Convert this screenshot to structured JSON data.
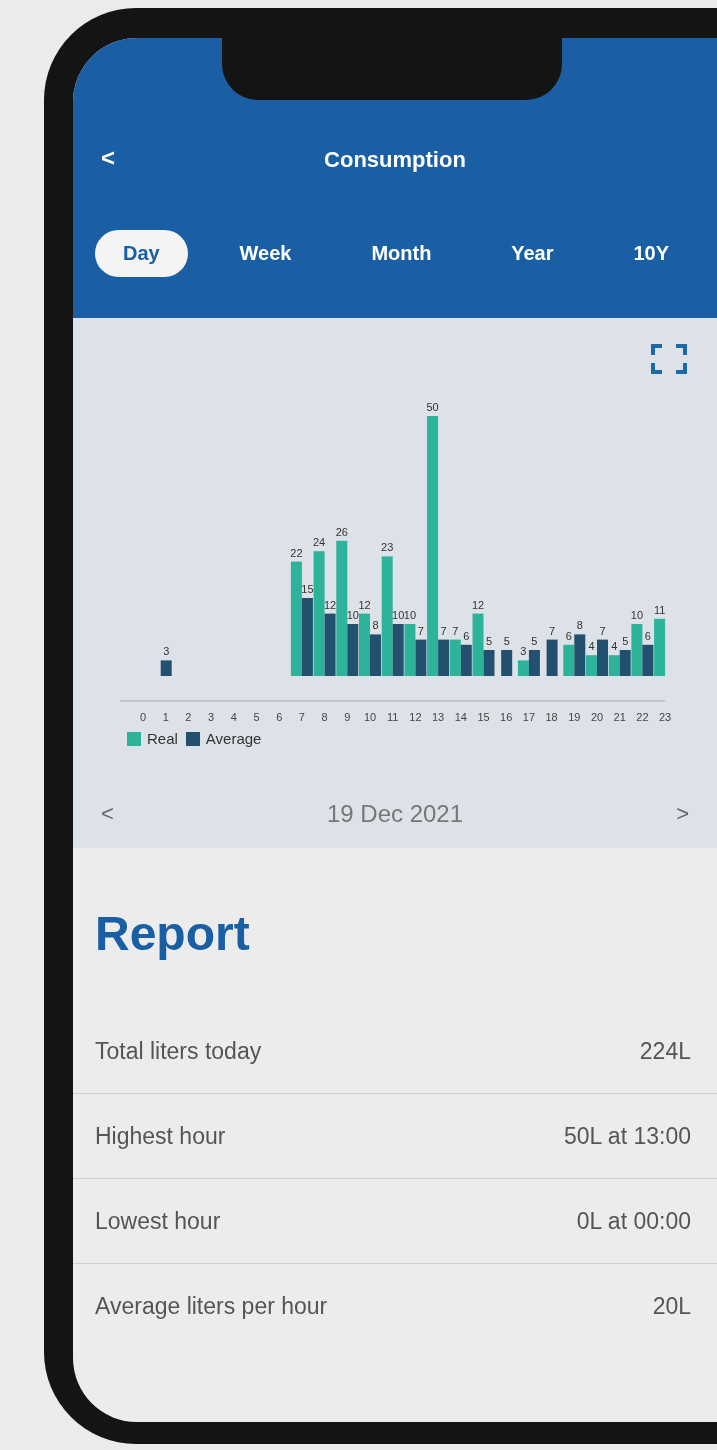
{
  "header": {
    "title": "Consumption",
    "back": "<"
  },
  "tabs": [
    {
      "label": "Day",
      "selected": true
    },
    {
      "label": "Week",
      "selected": false
    },
    {
      "label": "Month",
      "selected": false
    },
    {
      "label": "Year",
      "selected": false
    },
    {
      "label": "10Y",
      "selected": false
    }
  ],
  "chart": {
    "chart_data": {
      "type": "bar",
      "categories": [
        "0",
        "1",
        "2",
        "3",
        "4",
        "5",
        "6",
        "7",
        "8",
        "9",
        "10",
        "11",
        "12",
        "13",
        "14",
        "15",
        "16",
        "17",
        "18",
        "19",
        "20",
        "21",
        "22",
        "23"
      ],
      "data_labels": true,
      "series": [
        {
          "name": "Real",
          "color": "#2db39a",
          "values": [
            null,
            null,
            null,
            null,
            null,
            null,
            null,
            22,
            24,
            26,
            12,
            23,
            10,
            50,
            7,
            12,
            null,
            3,
            null,
            6,
            4,
            4,
            10,
            11
          ]
        },
        {
          "name": "Average",
          "color": "#24506f",
          "values": [
            null,
            3,
            null,
            null,
            null,
            null,
            null,
            15,
            12,
            10,
            8,
            10,
            7,
            7,
            6,
            5,
            5,
            5,
            7,
            8,
            7,
            5,
            6,
            null
          ]
        }
      ]
    }
  },
  "date_nav": {
    "prev": "<",
    "date": "19 Dec 2021",
    "next": ">"
  },
  "report": {
    "title": "Report",
    "rows": [
      {
        "label": "Total liters today",
        "value": "224L"
      },
      {
        "label": "Highest hour",
        "value": "50L at 13:00"
      },
      {
        "label": "Lowest hour",
        "value": "0L at 00:00"
      },
      {
        "label": "Average liters per hour",
        "value": "20L"
      }
    ]
  }
}
